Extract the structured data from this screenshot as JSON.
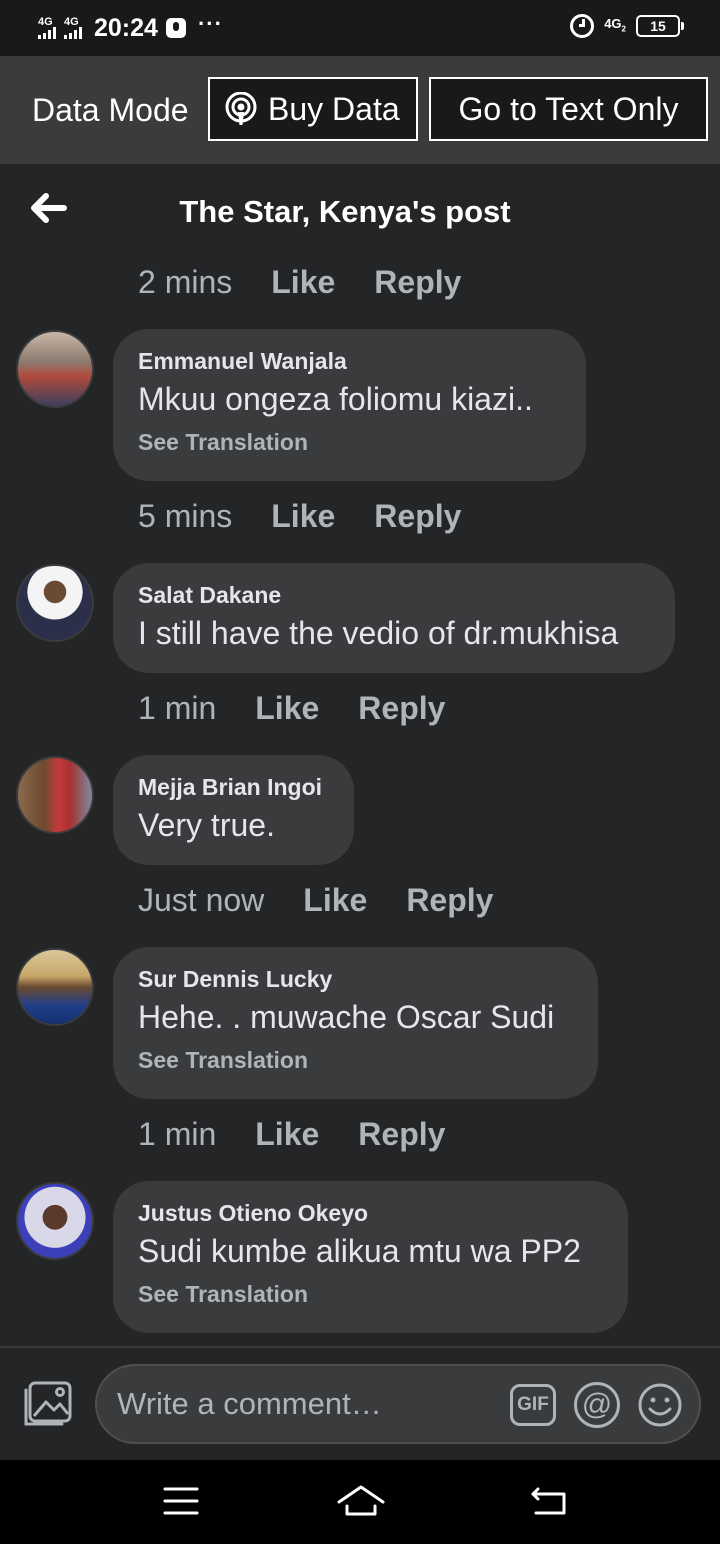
{
  "status_bar": {
    "signal1_label": "4G",
    "signal2_label": "4G",
    "time": "20:24",
    "dots": "···",
    "network": "4G",
    "network_sub": "2",
    "battery": "15"
  },
  "data_mode": {
    "label": "Data Mode",
    "buy_data": "Buy Data",
    "text_only": "Go to Text Only"
  },
  "header": {
    "title": "The Star, Kenya's post"
  },
  "top_meta": {
    "time": "2 mins",
    "like": "Like",
    "reply": "Reply"
  },
  "comments": [
    {
      "name": "Emmanuel Wanjala",
      "text": "Mkuu ongeza foliomu kiazi..",
      "translation": "See Translation",
      "time": "5 mins",
      "like": "Like",
      "reply": "Reply"
    },
    {
      "name": "Salat Dakane",
      "text": "I still have the vedio of dr.mukhisa",
      "translation": "",
      "time": "1 min",
      "like": "Like",
      "reply": "Reply"
    },
    {
      "name": "Mejja Brian Ingoi",
      "text": "Very true.",
      "translation": "",
      "time": "Just now",
      "like": "Like",
      "reply": "Reply"
    },
    {
      "name": "Sur Dennis Lucky",
      "text": "Hehe. . muwache Oscar Sudi",
      "translation": "See Translation",
      "time": "1 min",
      "like": "Like",
      "reply": "Reply"
    },
    {
      "name": "Justus Otieno Okeyo",
      "text": "Sudi kumbe alikua mtu wa PP2",
      "translation": "See Translation",
      "time": "",
      "like": "",
      "reply": ""
    }
  ],
  "composer": {
    "placeholder": "Write a comment…",
    "gif_label": "GIF",
    "at_label": "@"
  },
  "colors": {
    "background": "#242526",
    "bubble": "#3a3b3c",
    "secondary_text": "#b0b3b8"
  },
  "icons": [
    "back-arrow-icon",
    "podcast-icon",
    "photo-icon",
    "gif-icon",
    "mention-icon",
    "emoji-icon",
    "menu-icon",
    "home-icon",
    "back-nav-icon",
    "alarm-icon"
  ]
}
